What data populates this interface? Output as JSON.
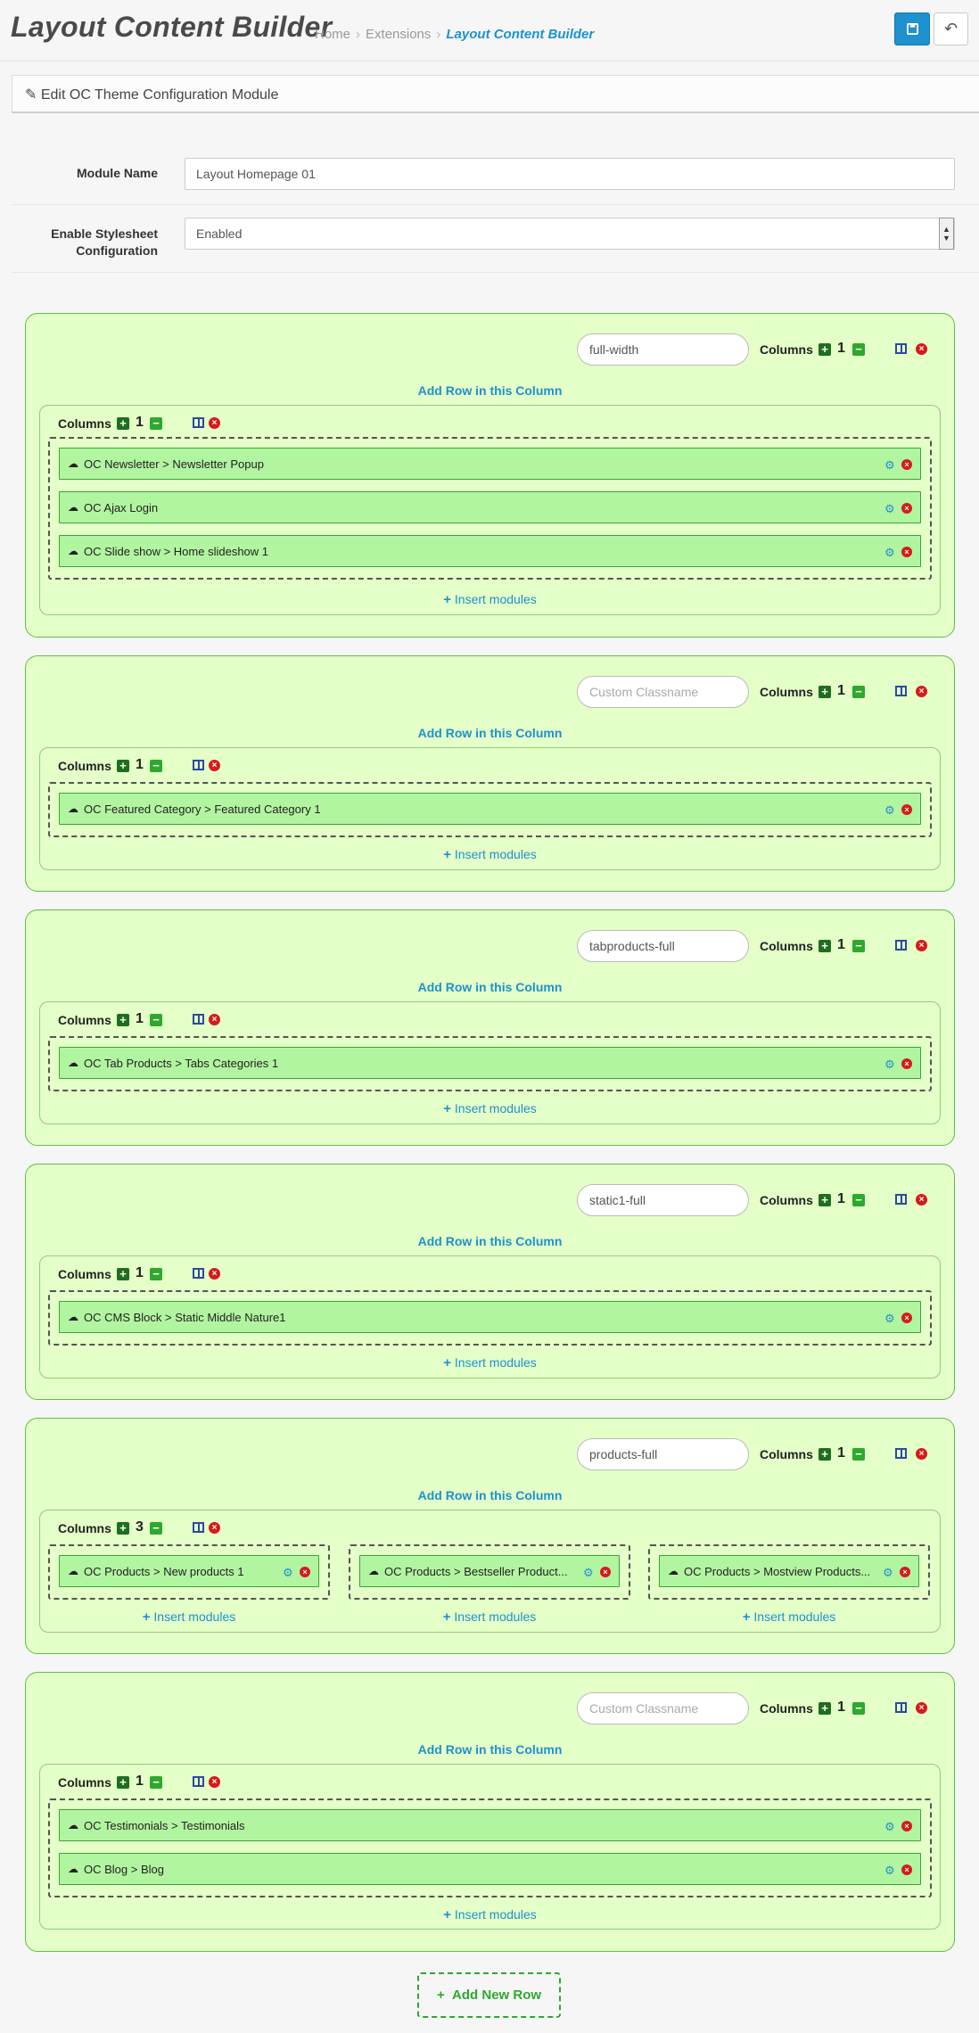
{
  "header": {
    "title": "Layout Content Builder",
    "breadcrumb": [
      "Home",
      "Extensions",
      "Layout Content Builder"
    ],
    "save_icon": "save-icon",
    "back_icon": "undo-icon"
  },
  "panel": {
    "heading": "Edit OC Theme Configuration Module",
    "heading_icon": "pencil-icon"
  },
  "form": {
    "module_name_label": "Module Name",
    "module_name_value": "Layout Homepage 01",
    "stylesheet_label_1": "Enable Stylesheet",
    "stylesheet_label_2": "Configuration",
    "stylesheet_value": "Enabled"
  },
  "labels": {
    "columns": "Columns",
    "add_row": "Add Row in this Column",
    "insert_modules": "Insert modules",
    "add_new_row": "Add New Row"
  },
  "rows": [
    {
      "classname": "full-width",
      "placeholder": "Custom Classname",
      "columns": "1",
      "cols": [
        {
          "count": "1",
          "modules": [
            "OC Newsletter > Newsletter Popup",
            "OC Ajax Login",
            "OC Slide show > Home slideshow 1"
          ]
        }
      ]
    },
    {
      "classname": "",
      "placeholder": "Custom Classname",
      "columns": "1",
      "cols": [
        {
          "count": "1",
          "modules": [
            "OC Featured Category > Featured Category 1"
          ]
        }
      ]
    },
    {
      "classname": "tabproducts-full",
      "placeholder": "Custom Classname",
      "columns": "1",
      "cols": [
        {
          "count": "1",
          "modules": [
            "OC Tab Products > Tabs Categories 1"
          ]
        }
      ]
    },
    {
      "classname": "static1-full",
      "placeholder": "Custom Classname",
      "columns": "1",
      "cols": [
        {
          "count": "1",
          "modules": [
            "OC CMS Block > Static Middle Nature1"
          ]
        }
      ]
    },
    {
      "classname": "products-full",
      "placeholder": "Custom Classname",
      "columns": "1",
      "cols": [
        {
          "count": "3",
          "modules": [
            "OC Products > New products 1",
            "OC Products > Bestseller Product...",
            "OC Products > Mostview Products..."
          ]
        }
      ]
    },
    {
      "classname": "",
      "placeholder": "Custom Classname",
      "columns": "1",
      "cols": [
        {
          "count": "1",
          "modules": [
            "OC Testimonials > Testimonials",
            "OC Blog > Blog"
          ]
        }
      ]
    }
  ]
}
